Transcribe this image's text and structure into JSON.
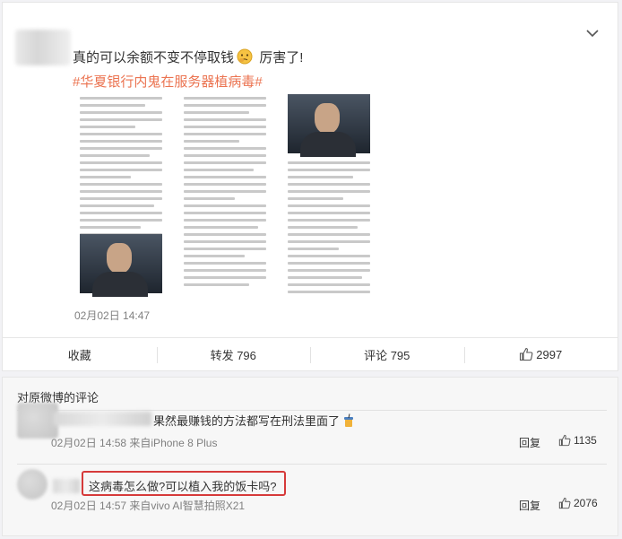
{
  "post": {
    "text": "真的可以余额不变不停取钱",
    "text_suffix": "厉害了!",
    "emoji": "thinking-emoji",
    "hashtag": "#华夏银行内鬼在服务器植病毒#",
    "timestamp": "02月02日 14:47"
  },
  "actions": {
    "collect": "收藏",
    "repost": "转发 796",
    "comment": "评论 795",
    "like_count": "2997"
  },
  "comments": {
    "title": "对原微博的评论",
    "items": [
      {
        "text": "果然最赚钱的方法都写在刑法里面了",
        "meta": "02月02日 14:58 来自iPhone 8 Plus",
        "reply": "回复",
        "likes": "1135"
      },
      {
        "text": "这病毒怎么做?可以植入我的饭卡吗?",
        "meta": "02月02日 14:57 来自vivo AI智慧拍照X21",
        "reply": "回复",
        "likes": "2076"
      }
    ]
  },
  "colors": {
    "hashtag": "#eb7350",
    "highlight": "#d63a3a"
  }
}
